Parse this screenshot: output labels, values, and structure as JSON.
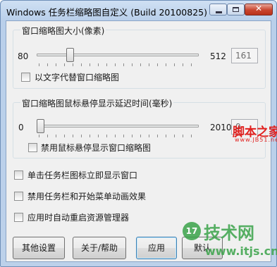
{
  "window": {
    "title": "Windows 任务栏缩略图自定义 (Build 20100825)",
    "controls": {
      "minimize": "minimize",
      "maximize": "maximize",
      "close": "✕"
    }
  },
  "group_size": {
    "title": "窗口缩略图大小(像素)",
    "min_label": "80",
    "max_label": "512",
    "value": "161",
    "slider_fraction": 0.19,
    "checkbox_label": "以文字代替窗口缩略图",
    "checkbox_checked": false
  },
  "group_delay": {
    "title": "窗口缩略图鼠标悬停显示延迟时间(毫秒)",
    "min_label": "0",
    "max_label": "2010",
    "value": "0",
    "slider_fraction": 0.0,
    "checkbox_label": "禁用鼠标悬停显示窗口缩略图",
    "checkbox_checked": false
  },
  "options": [
    {
      "label": "单击任务栏图标立即显示窗口",
      "checked": false
    },
    {
      "label": "禁用任务栏和开始菜单动画效果",
      "checked": false
    },
    {
      "label": "应用时自动重启资源管理器",
      "checked": false
    }
  ],
  "buttons": {
    "other_settings": "其他设置",
    "about_help": "关于/帮助",
    "apply": "应用",
    "restore": "默认"
  },
  "watermarks": {
    "jb51_title": "脚本之家",
    "jb51_url": "www.JB51.net",
    "itjs_mark": "17",
    "itjs_title": "技术网",
    "itjs_url": "www.itjs.cn"
  },
  "colors": {
    "watermark_red": "#e0201e",
    "watermark_green": "#3aa34a",
    "title_frame": "#b9cfea"
  }
}
